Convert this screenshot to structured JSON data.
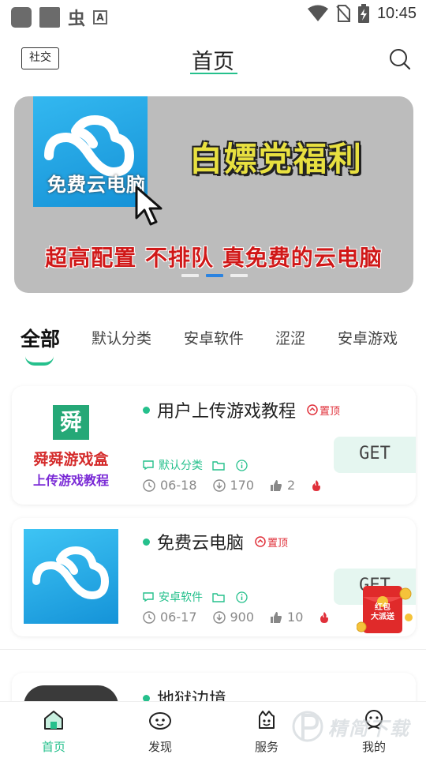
{
  "status_bar": {
    "time": "10:45",
    "icons": [
      "app-icon-1",
      "app-icon-2",
      "bug-icon",
      "keyboard-icon",
      "wifi-icon",
      "no-sim-icon",
      "battery-charging-icon"
    ]
  },
  "header": {
    "social_label": "社交",
    "title": "首页",
    "search_icon": "search-icon"
  },
  "banner": {
    "logo_text": "免费云电脑",
    "headline": "白嫖党福利",
    "subline": "超高配置 不排队 真免费的云电脑",
    "slides": 3,
    "active_slide": 2
  },
  "tabs": [
    {
      "label": "全部",
      "active": true
    },
    {
      "label": "默认分类",
      "active": false
    },
    {
      "label": "安卓软件",
      "active": false
    },
    {
      "label": "涩涩",
      "active": false
    },
    {
      "label": "安卓游戏",
      "active": false
    }
  ],
  "apps": [
    {
      "name": "用户上传游戏教程",
      "pinned_label": "置顶",
      "category": "默认分类",
      "date": "06-18",
      "downloads": "170",
      "likes": "2",
      "thumb_logo": "舜",
      "thumb_line1": "舜舜游戏盒",
      "thumb_line2": "上传游戏教程",
      "get_label": "GET"
    },
    {
      "name": "免费云电脑",
      "pinned_label": "置顶",
      "category": "安卓软件",
      "date": "06-17",
      "downloads": "900",
      "likes": "10",
      "get_label": "GET"
    },
    {
      "name": "地狱边境"
    }
  ],
  "red_envelope": {
    "line1": "红包",
    "line2": "大派送"
  },
  "bottom_nav": [
    {
      "label": "首页",
      "icon": "home-icon",
      "active": true
    },
    {
      "label": "发现",
      "icon": "discover-icon",
      "active": false
    },
    {
      "label": "服务",
      "icon": "service-icon",
      "active": false
    },
    {
      "label": "我的",
      "icon": "profile-icon",
      "active": false
    }
  ],
  "watermark": "精简下载",
  "colors": {
    "accent": "#25c08c",
    "pin_red": "#e0303a",
    "get_bg": "#e5f6f0"
  }
}
